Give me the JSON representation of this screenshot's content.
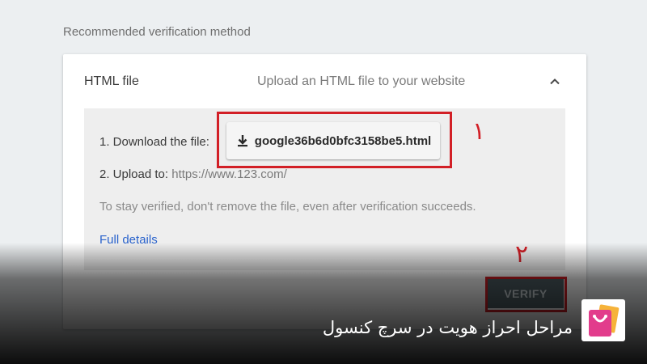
{
  "section_label": "Recommended verification method",
  "method": {
    "title": "HTML file",
    "description": "Upload an HTML file to your website",
    "collapse_icon": "chevron-up-icon"
  },
  "steps": {
    "step1_label": "1. Download the file:",
    "download_filename": "google36b6d0bfc3158be5.html",
    "download_icon": "download-icon",
    "step2_label": "2. Upload to:",
    "step2_url": "https://www.123.com/",
    "note": "To stay verified, don't remove the file, even after verification succeeds.",
    "details_link": "Full details"
  },
  "verify_button": "VERIFY",
  "annotations": {
    "marker1": "۱",
    "marker2": "۲",
    "color": "#d21f26"
  },
  "caption": "مراحل احراز هویت در سرچ کنسول",
  "logo_icon": "shopping-bag-icon"
}
